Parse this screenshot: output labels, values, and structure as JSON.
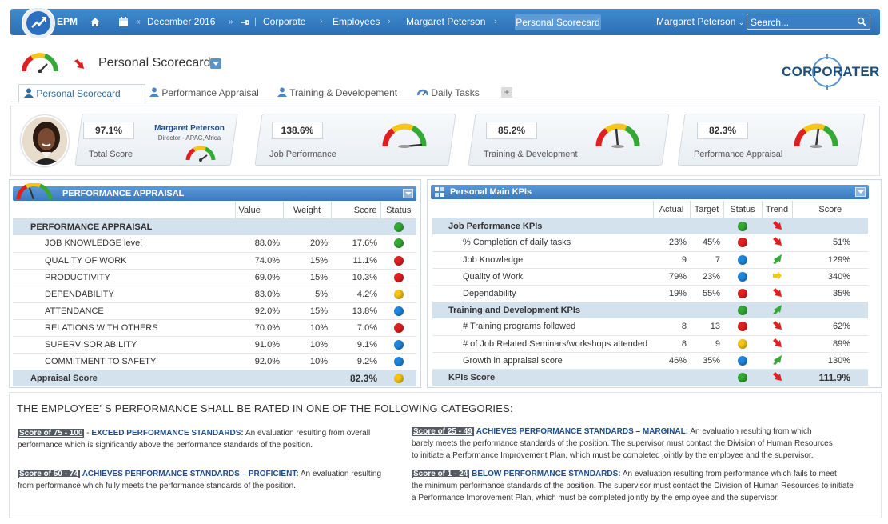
{
  "nav": {
    "app": "EPM",
    "period": "December 2016",
    "crumbs": [
      "Corporate",
      "Employees",
      "Margaret Peterson",
      "Personal Scorecard"
    ],
    "user": "Margaret Peterson",
    "search_placeholder": "Search..."
  },
  "header": {
    "title": "Personal Scorecard",
    "brand": "CORPORATER"
  },
  "tabs": [
    "Personal Scorecard",
    "Performance Appraisal",
    "Training & Developement",
    "Daily Tasks"
  ],
  "summary": {
    "employee_name": "Margaret Peterson",
    "employee_role": "Director - APAC,Africa",
    "total_score": "97.1%",
    "total_label": "Total Score",
    "cards": [
      {
        "value": "138.6%",
        "label": "Job Performance"
      },
      {
        "value": "85.2%",
        "label": "Training & Development"
      },
      {
        "value": "82.3%",
        "label": "Performance Appraisal"
      }
    ]
  },
  "appraisal": {
    "title": "PERFORMANCE APPRAISAL",
    "columns": [
      "Value",
      "Weight",
      "Score",
      "Status"
    ],
    "group": "PERFORMANCE APPRAISAL",
    "group_status": "green",
    "rows": [
      {
        "name": "JOB KNOWLEDGE level",
        "value": "88.0%",
        "weight": "20%",
        "score": "17.6%",
        "status": "green"
      },
      {
        "name": "QUALITY OF WORK",
        "value": "74.0%",
        "weight": "15%",
        "score": "11.1%",
        "status": "red"
      },
      {
        "name": "PRODUCTIVITY",
        "value": "69.0%",
        "weight": "15%",
        "score": "10.3%",
        "status": "red"
      },
      {
        "name": "DEPENDABILITY",
        "value": "83.0%",
        "weight": "5%",
        "score": "4.2%",
        "status": "yellow"
      },
      {
        "name": "ATTENDANCE",
        "value": "92.0%",
        "weight": "15%",
        "score": "13.8%",
        "status": "blue"
      },
      {
        "name": "RELATIONS WITH OTHERS",
        "value": "70.0%",
        "weight": "10%",
        "score": "7.0%",
        "status": "red"
      },
      {
        "name": "SUPERVISOR ABILITY",
        "value": "91.0%",
        "weight": "10%",
        "score": "9.1%",
        "status": "blue"
      },
      {
        "name": "COMMITMENT TO SAFETY",
        "value": "92.0%",
        "weight": "10%",
        "score": "9.2%",
        "status": "blue"
      }
    ],
    "total_label": "Appraisal Score",
    "total_score": "82.3%",
    "total_status": "yellow"
  },
  "kpis": {
    "title": "Personal Main KPIs",
    "columns": [
      "Actual",
      "Target",
      "Status",
      "Trend",
      "Score"
    ],
    "groups": [
      {
        "name": "Job Performance KPIs",
        "status": "green",
        "trend": "down-red",
        "rows": [
          {
            "name": "% Completion of daily tasks",
            "actual": "23%",
            "target": "45%",
            "status": "red",
            "trend": "down-red",
            "score": "51%"
          },
          {
            "name": "Job Knowledge",
            "actual": "9",
            "target": "7",
            "status": "blue",
            "trend": "up-green",
            "score": "129%"
          },
          {
            "name": "Quality of Work",
            "actual": "79%",
            "target": "23%",
            "status": "blue",
            "trend": "right-yellow",
            "score": "340%"
          },
          {
            "name": "Dependability",
            "actual": "19%",
            "target": "55%",
            "status": "red",
            "trend": "down-red",
            "score": "35%"
          }
        ]
      },
      {
        "name": "Training and Development KPIs",
        "status": "green",
        "trend": "up-green",
        "rows": [
          {
            "name": "# Training programs followed",
            "actual": "8",
            "target": "13",
            "status": "red",
            "trend": "down-red",
            "score": "62%"
          },
          {
            "name": "# of Job Related Seminars/workshops attended",
            "actual": "8",
            "target": "9",
            "status": "yellow",
            "trend": "down-red",
            "score": "89%"
          },
          {
            "name": "Growth in appraisal score",
            "actual": "46%",
            "target": "35%",
            "status": "blue",
            "trend": "up-green",
            "score": "130%"
          }
        ]
      }
    ],
    "total_label": "KPIs Score",
    "total_score": "111.9%",
    "total_status": "green",
    "total_trend": "down-red"
  },
  "legend": {
    "title": "THE EMPLOYEE' S PERFORMANCE SHALL BE RATED IN ONE OF THE FOLLOWING CATEGORIES:",
    "items": [
      {
        "badge": "Score of 75 - 100",
        "sep": " - ",
        "head": "EXCEED PERFORMANCE STANDARDS:",
        "line1": " An evaluation resulting from overall",
        "line2": "performance which is significantly above the performance standards of the position."
      },
      {
        "badge": "Score of 50 - 74",
        "sep": " ",
        "head": "ACHIEVES PERFORMANCE STANDARDS – PROFICIENT:",
        "line1": " An evaluation resulting",
        "line2": "from performance which fully meets the performance standards of the position."
      },
      {
        "badge": "Score of 25 - 49",
        "sep": "  ",
        "head": "ACHIEVES PERFORMANCE STANDARDS – MARGINAL:",
        "line1": " An evaluation resulting from which",
        "line2": "barely meets the performance standards of the position. The supervisor must contact the Division of Human Resources",
        "line3": "to initiate a Performance Improvement Plan, which must be completed jointly by the employee and the supervisor."
      },
      {
        "badge": "Score of 1 - 24",
        "sep": "  ",
        "head": "BELOW PERFORMANCE STANDARDS:",
        "line1": " An evaluation resulting from performance which fails to meet",
        "line2": "the minimum performance  standards of the position. The supervisor must contact the Division of Human Resources to initiate",
        "line3": "a Performance Improvement Plan, which must be completed jointly by the employee and the supervisor."
      }
    ]
  },
  "colors": {
    "nav": "#2f74b8",
    "header_bar": "#4a8ccc",
    "group_row": "#d4e2ee",
    "brand": "#1e4f7a"
  }
}
